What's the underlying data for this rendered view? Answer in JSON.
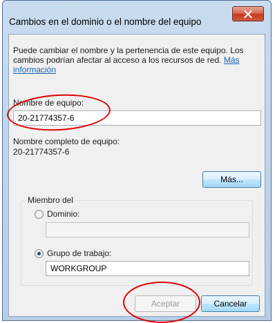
{
  "window": {
    "title": "Cambios en el dominio o el nombre del equipo"
  },
  "intro": {
    "text": "Puede cambiar el nombre y la pertenencia de este equipo. Los cambios podrían afectar al acceso a los recursos de red. ",
    "link": "Más información"
  },
  "computer_name": {
    "label": "Nombre de equipo:",
    "value": "20-21774357-6"
  },
  "full_name": {
    "label": "Nombre completo de equipo:",
    "value": "20-21774357-6"
  },
  "more_button": "Más...",
  "member_of": {
    "title": "Miembro del",
    "domain": {
      "label": "Dominio:",
      "value": "",
      "selected": false
    },
    "workgroup": {
      "label": "Grupo de trabajo:",
      "value": "WORKGROUP",
      "selected": true
    }
  },
  "buttons": {
    "ok": "Aceptar",
    "cancel": "Cancelar"
  },
  "colors": {
    "annotation": "#e00000",
    "link": "#1a5fb4",
    "close": "#c43a1e"
  },
  "icons": {
    "close": "close-icon"
  }
}
